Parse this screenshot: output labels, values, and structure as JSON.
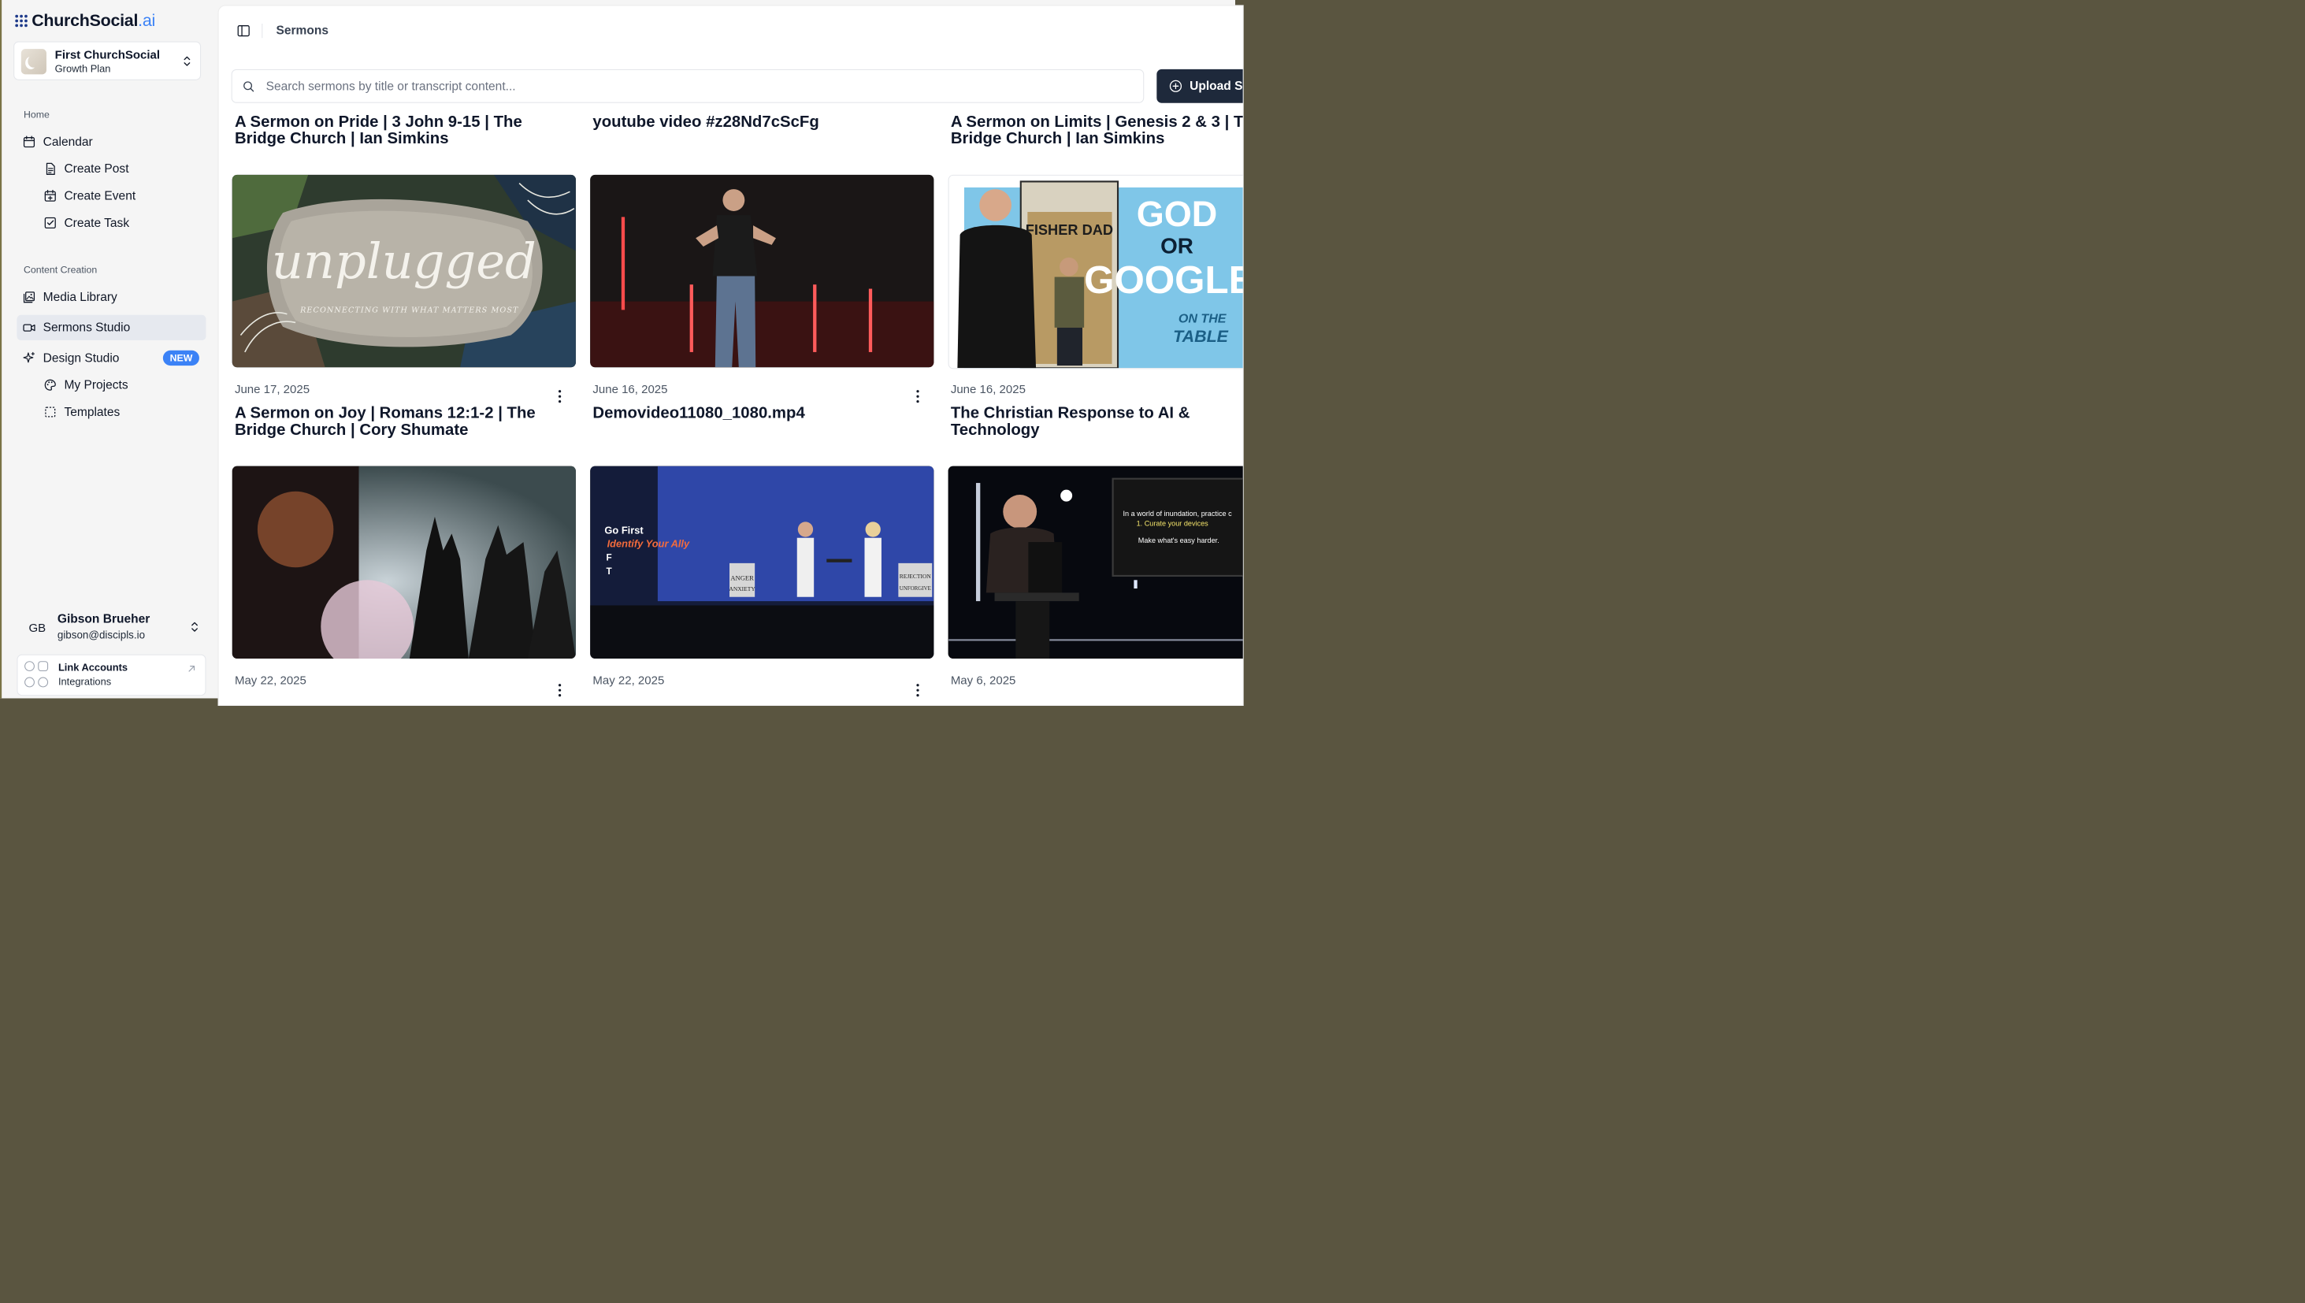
{
  "brand": {
    "name": "ChurchSocial",
    "suffix": ".ai",
    "accent": "#3b82f6",
    "dark": "#1e293b"
  },
  "org": {
    "name": "First ChurchSocial",
    "plan": "Growth Plan"
  },
  "sidebar": {
    "home_label": "Home",
    "content_label": "Content Creation",
    "items": [
      {
        "label": "Calendar",
        "icon": "calendar-icon"
      },
      {
        "label": "Create Post",
        "icon": "file-text-icon"
      },
      {
        "label": "Create Event",
        "icon": "calendar-plus-icon"
      },
      {
        "label": "Create Task",
        "icon": "check-square-icon"
      },
      {
        "label": "Media Library",
        "icon": "image-gallery-icon"
      },
      {
        "label": "Sermons Studio",
        "icon": "video-camera-icon",
        "active": true
      },
      {
        "label": "Design Studio",
        "icon": "sparkle-icon",
        "badge": "NEW"
      },
      {
        "label": "My Projects",
        "icon": "palette-icon"
      },
      {
        "label": "Templates",
        "icon": "dashed-square-icon"
      }
    ]
  },
  "user": {
    "initials": "GB",
    "name": "Gibson Brueher",
    "email": "gibson@discipls.io"
  },
  "link_accounts": {
    "title": "Link Accounts",
    "subtitle": "Integrations"
  },
  "header": {
    "title": "Sermons"
  },
  "search": {
    "placeholder": "Search sermons by title or transcript content..."
  },
  "upload": {
    "label": "Upload S"
  },
  "rows": [
    {
      "cards": [
        {
          "title": "A Sermon on Pride | 3 John 9-15 | The Bridge Church | Ian Simkins"
        },
        {
          "title": "youtube video #z28Nd7cScFg"
        },
        {
          "title": "A Sermon on Limits | Genesis 2 & 3 | The Bridge Church | Ian Simkins"
        }
      ]
    },
    {
      "cards": [
        {
          "date": "June 17, 2025",
          "title": "A Sermon on Joy | Romans 12:1-2 | The Bridge Church | Cory Shumate",
          "thumb": {
            "text": "unplugged",
            "subtext": "RECONNECTING WITH WHAT MATTERS MOST"
          }
        },
        {
          "date": "June 16, 2025",
          "title": "Demovideo11080_1080.mp4"
        },
        {
          "date": "June 16, 2025",
          "title": "The Christian Response to AI & Technology",
          "thumb": {
            "sign": "FISHER DAD",
            "line1": "GOD",
            "line2": "OR",
            "line3": "GOOGLE",
            "badge1": "ON THE",
            "badge2": "TABLE"
          }
        }
      ]
    },
    {
      "cards": [
        {
          "date": "May 22, 2025"
        },
        {
          "date": "May 22, 2025",
          "thumb": {
            "l1": "Go First",
            "l2": "Identify Your Ally",
            "l3": "F",
            "l4": "T",
            "s1": "ANGER",
            "s2": "ANXIETY",
            "s3": "REJECTION",
            "s4": "UNFORGIVE"
          }
        },
        {
          "date": "May 6, 2025",
          "thumb": {
            "screen1": "In a world of inundation, practice c",
            "screen2": "1. Curate your devices",
            "screen3": "Make what's easy harder."
          }
        }
      ]
    }
  ]
}
